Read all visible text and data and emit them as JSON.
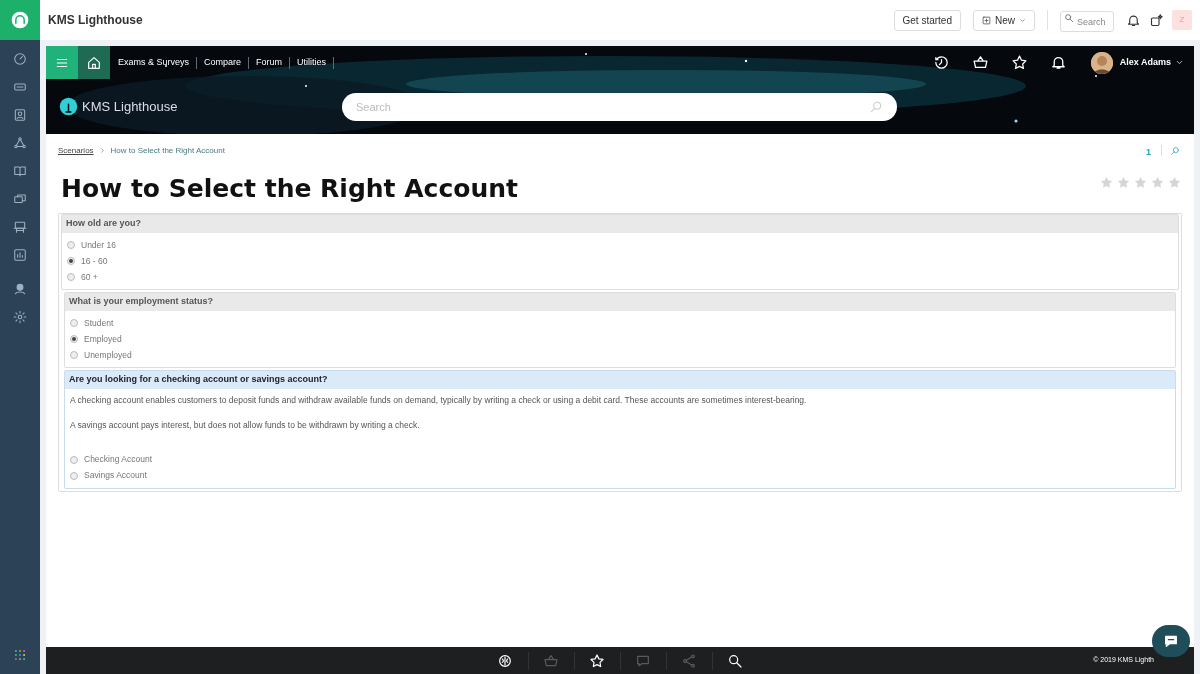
{
  "app_bar": {
    "title": "KMS Lighthouse",
    "buttons": [
      "Get started",
      "New"
    ],
    "search": {
      "placeholder": "Search"
    },
    "avatar": "Z"
  },
  "nav": {
    "menu": [
      "Exams & Surveys",
      "Compare",
      "Forum",
      "Utilities"
    ],
    "user": "Alex Adams"
  },
  "banner": {
    "logo": "KMS Lighthouse",
    "search": {
      "placeholder": "Search"
    }
  },
  "breadcrumb": [
    "Scenarios",
    "How to Select the Right Account"
  ],
  "count": "1",
  "title": "How to Select the Right Account",
  "rating": {
    "stars": 0
  },
  "questions": [
    {
      "question": "How old are you?",
      "active": false,
      "options": [
        {
          "label": "Under 16",
          "selected": false
        },
        {
          "label": "16 - 60",
          "selected": true
        },
        {
          "label": "60 +",
          "selected": false
        }
      ]
    },
    {
      "question": "What is your employment status?",
      "active": false,
      "options": [
        {
          "label": "Student",
          "selected": false
        },
        {
          "label": "Employed",
          "selected": true
        },
        {
          "label": "Unemployed",
          "selected": false
        }
      ]
    },
    {
      "question": "Are you looking for a checking account or savings account?",
      "active": true,
      "text": [
        "A checking account enables customers to deposit funds and withdraw available funds on demand, typically by writing a check or using a debit card. These accounts are sometimes interest-bearing.",
        "A savings account pays interest, but does not allow funds to be withdrawn by writing a check."
      ],
      "options": [
        {
          "label": "Checking Account",
          "selected": false
        },
        {
          "label": "Savings Account",
          "selected": false
        }
      ]
    }
  ],
  "footer": {
    "tools": [
      {
        "disabled": false
      },
      {
        "disabled": true
      },
      {
        "disabled": false
      },
      {
        "disabled": true
      },
      {
        "disabled": true
      },
      {
        "disabled": false
      }
    ],
    "copyright": "© 2019 KMS Lighth"
  }
}
